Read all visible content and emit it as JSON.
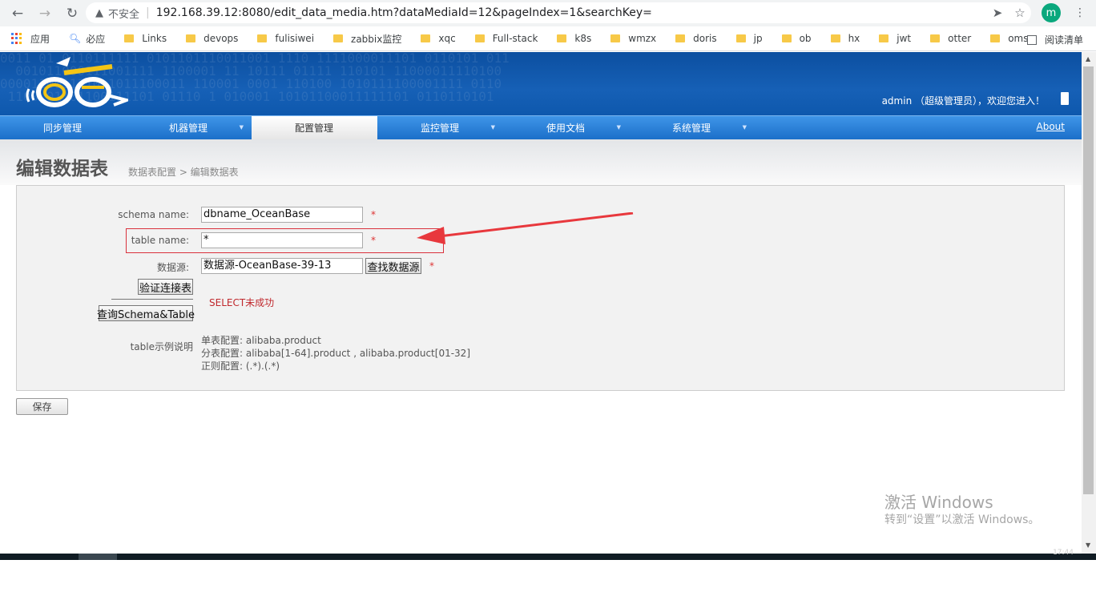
{
  "browser": {
    "insecure_label": "不安全",
    "url": "192.168.39.12:8080/edit_data_media.htm?dataMediaId=12&pageIndex=1&searchKey=",
    "profile_initial": "m",
    "bookmarks": [
      "应用",
      "必应",
      "Links",
      "devops",
      "fulisiwei",
      "zabbix监控",
      "xqc",
      "Full-stack",
      "k8s",
      "wmzx",
      "doris",
      "jp",
      "ob",
      "hx",
      "jwt",
      "otter",
      "oms"
    ],
    "reading_list": "阅读清单"
  },
  "header": {
    "welcome": "admin （超级管理员），欢迎您进入！",
    "binary": "0011 01 0110111111 0101101110011001 1110 1111000011101 0110101 011\n  001011000111001111 1100001 11 10111 01111 110101 11000011110100\n0000110011110 1011100011 110001 0001 110100 1010111100001111 0110\n 1100 01101100111101 01110 1 010001 10101100011111101 0110110101"
  },
  "nav": {
    "items": [
      {
        "label": "同步管理",
        "has_menu": false,
        "active": false
      },
      {
        "label": "机器管理",
        "has_menu": true,
        "active": false
      },
      {
        "label": "配置管理",
        "has_menu": false,
        "active": true
      },
      {
        "label": "监控管理",
        "has_menu": true,
        "active": false
      },
      {
        "label": "使用文档",
        "has_menu": true,
        "active": false
      },
      {
        "label": "系统管理",
        "has_menu": true,
        "active": false
      }
    ],
    "about": "About",
    "caret": "▼"
  },
  "page": {
    "title": "编辑数据表",
    "breadcrumb": "数据表配置 > 编辑数据表"
  },
  "form": {
    "schema_label": "schema name:",
    "schema_value": "dbname_OceanBase",
    "table_label": "table name:",
    "table_value": "*",
    "datasource_label": "数据源:",
    "datasource_value": "数据源-OceanBase-39-13",
    "find_datasource_button": "查找数据源",
    "required_mark": "*",
    "verify_button": "验证连接表",
    "query_button": "查询Schema&Table",
    "error_text": "SELECT未成功",
    "example_label": "table示例说明",
    "examples": [
      "单表配置: alibaba.product",
      "分表配置: alibaba[1-64].product , alibaba.product[01-32]",
      "正则配置: (.*).(.*)"
    ],
    "save_button": "保存"
  },
  "watermark": {
    "line1": "激活 Windows",
    "line2": "转到“设置”以激活 Windows。"
  },
  "taskbar": {
    "clock": "17:44"
  }
}
